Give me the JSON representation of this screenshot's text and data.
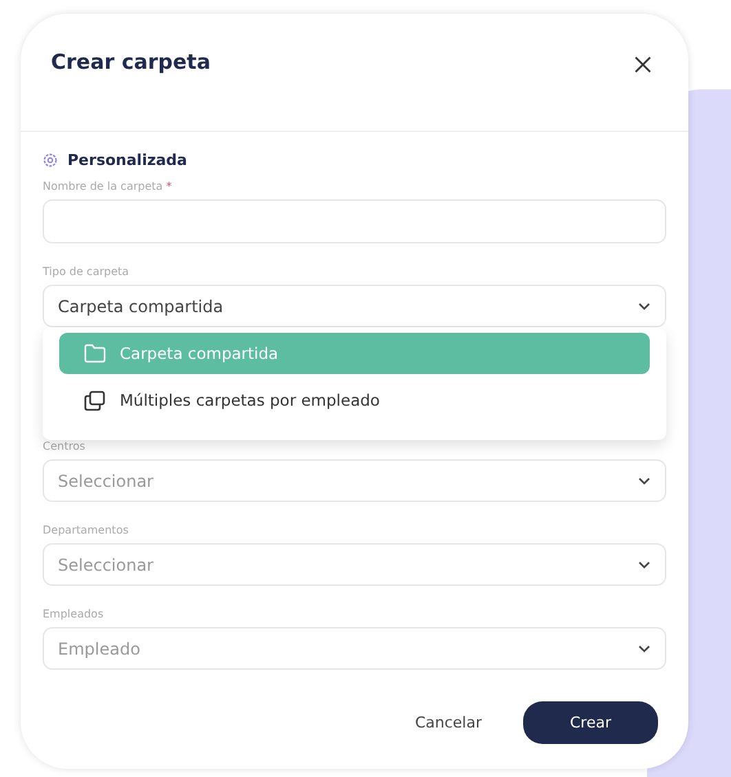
{
  "dialog": {
    "title": "Crear carpeta",
    "section": "Personalizada",
    "fields": [
      {
        "kind": "text",
        "label": "Nombre de la carpeta",
        "required": true,
        "required_mark": "*"
      },
      {
        "kind": "select",
        "label": "Tipo de carpeta",
        "value": "Carpeta compartida",
        "open": true,
        "options": [
          {
            "label": "Carpeta compartida",
            "kind": "single",
            "selected": true
          },
          {
            "label": "Múltiples carpetas por empleado",
            "kind": "multiple",
            "selected": false
          }
        ]
      },
      {
        "kind": "select",
        "label": "Centros",
        "placeholder": "Seleccionar"
      },
      {
        "kind": "select",
        "label": "Departamentos",
        "placeholder": "Seleccionar"
      },
      {
        "kind": "select",
        "label": "Empleados",
        "placeholder": "Empleado"
      }
    ],
    "buttons": [
      {
        "label": "Cancelar",
        "kind": "secondary"
      },
      {
        "label": "Crear",
        "kind": "primary"
      }
    ]
  }
}
